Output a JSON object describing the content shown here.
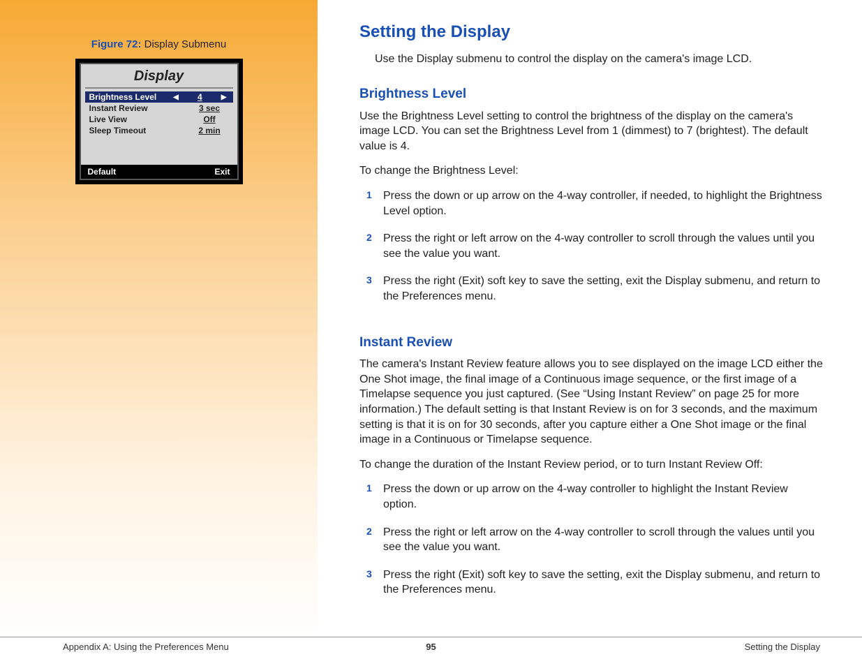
{
  "sidebar": {
    "figure_label": "Figure 72:",
    "figure_title": " Display Submenu",
    "lcd": {
      "title": "Display",
      "rows": [
        {
          "label": "Brightness Level",
          "value": "4",
          "selected": true
        },
        {
          "label": "Instant Review",
          "value": "3 sec",
          "selected": false
        },
        {
          "label": "Live View",
          "value": "Off",
          "selected": false
        },
        {
          "label": "Sleep Timeout",
          "value": "2 min",
          "selected": false
        }
      ],
      "footer_left": "Default",
      "footer_right": "Exit"
    }
  },
  "content": {
    "h1": "Setting the Display",
    "intro": "Use the Display submenu to control the display on the camera's image LCD.",
    "section1": {
      "title": "Brightness Level",
      "p1": "Use the Brightness Level setting to control the brightness of the display on the camera's image LCD. You can set the Brightness Level from 1 (dimmest) to 7 (brightest). The default value is 4.",
      "p2": "To change the Brightness Level:",
      "steps": [
        "Press the down or up arrow on the 4-way controller, if needed, to highlight the Brightness Level option.",
        "Press the right or left arrow on the 4-way controller to scroll through the values until you see the value you want.",
        "Press the right (Exit) soft key to save the setting, exit the Display submenu, and return to the Preferences menu."
      ]
    },
    "section2": {
      "title": "Instant Review",
      "p1": "The camera's Instant Review feature allows you to see displayed on the image LCD either the One Shot image, the final image of a Continuous image sequence, or the first image of a Timelapse sequence you just captured. (See “Using Instant Review” on page 25 for more information.) The default setting is that Instant Review is on for 3 seconds, and the maximum setting is that it is on for 30 seconds, after you capture either a One Shot image or the final image in a Continuous or Timelapse sequence.",
      "p2": "To change the duration of the Instant Review period, or to turn Instant Review Off:",
      "steps": [
        "Press the down or up arrow on the 4-way controller to highlight the Instant Review option.",
        "Press the right or left arrow on the 4-way controller to scroll through the values until you see the value you want.",
        "Press the right (Exit) soft key to save the setting, exit the Display submenu, and return to the Preferences menu."
      ]
    }
  },
  "footer": {
    "left": "Appendix A: Using the Preferences Menu",
    "center": "95",
    "right": "Setting the Display"
  }
}
